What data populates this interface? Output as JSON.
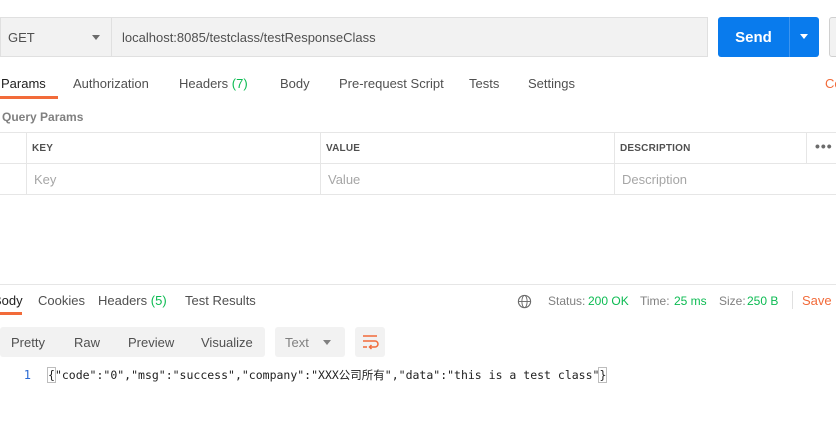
{
  "request": {
    "method": "GET",
    "url": "localhost:8085/testclass/testResponseClass",
    "send_label": "Send"
  },
  "request_tabs": [
    {
      "label": "Params",
      "count": ""
    },
    {
      "label": "Authorization",
      "count": ""
    },
    {
      "label": "Headers",
      "count": "(7)"
    },
    {
      "label": "Body",
      "count": ""
    },
    {
      "label": "Pre-request Script",
      "count": ""
    },
    {
      "label": "Tests",
      "count": ""
    },
    {
      "label": "Settings",
      "count": ""
    }
  ],
  "cookies_label": "Co",
  "query_params": {
    "title": "Query Params",
    "columns": [
      "KEY",
      "VALUE",
      "DESCRIPTION"
    ],
    "placeholders": {
      "key": "Key",
      "value": "Value",
      "description": "Description"
    },
    "more_label": "•••"
  },
  "response_tabs": [
    {
      "label": "Body",
      "count": ""
    },
    {
      "label": "Cookies",
      "count": ""
    },
    {
      "label": "Headers",
      "count": "(5)"
    },
    {
      "label": "Test Results",
      "count": ""
    }
  ],
  "response_status": {
    "status_label": "Status:",
    "status_value": "200 OK",
    "time_label": "Time:",
    "time_value": "25 ms",
    "size_label": "Size:",
    "size_value": "250 B",
    "save_label": "Save R"
  },
  "view_modes": [
    "Pretty",
    "Raw",
    "Preview",
    "Visualize"
  ],
  "format": "Text",
  "response_body": {
    "line_number": "1",
    "open_brace": "{",
    "content": "\"code\":\"0\",\"msg\":\"success\",\"company\":\"XXX公司所有\",\"data\":\"this is a test class\"",
    "close_brace": "}"
  },
  "colors": {
    "accent_orange": "#f26b3a",
    "primary_blue": "#097bed",
    "success_green": "#0cbb52"
  },
  "icons": {
    "globe": "globe-icon",
    "wrap": "wrap-lines-icon",
    "dropdown": "caret-down-icon"
  }
}
